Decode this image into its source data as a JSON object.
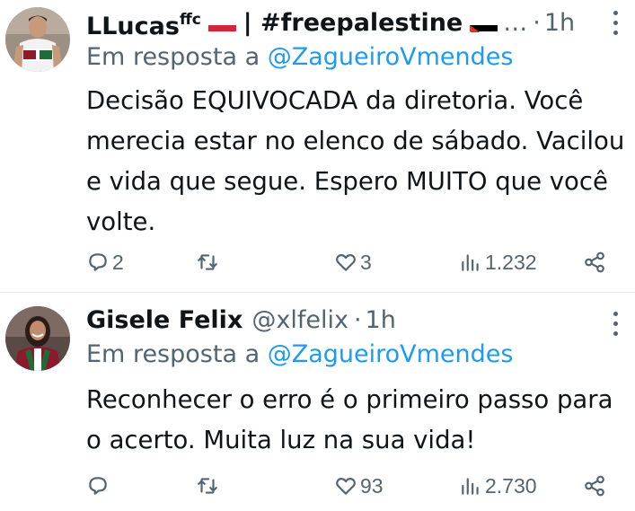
{
  "tweets": [
    {
      "display_name": "LLucas",
      "name_superscript": "ffc",
      "hashtag": "| #freepalestine",
      "ellipsis": "…",
      "separator": "·",
      "time": "1h",
      "reply_prefix": "Em resposta a",
      "reply_mention": "@ZagueiroVmendes",
      "text": "Decisão EQUIVOCADA da diretoria. Você merecia estar no elenco de sábado. Vacilou e vida que segue. Espero MUITO que você volte.",
      "replies": "2",
      "retweets": "",
      "likes": "3",
      "views": "1.232"
    },
    {
      "display_name": "Gisele Felix",
      "handle": "@xlfelix",
      "separator": "·",
      "time": "1h",
      "reply_prefix": "Em resposta a",
      "reply_mention": "@ZagueiroVmendes",
      "text": "Reconhecer o erro é o primeiro passo para o acerto. Muita luz na sua vida!",
      "replies": "",
      "retweets": "",
      "likes": "93",
      "views": "2.730"
    }
  ],
  "colors": {
    "text": "#0f1419",
    "secondary": "#536471",
    "mention": "#1d9bf0",
    "divider": "#e7e9ea"
  },
  "icons": [
    "reply-icon",
    "retweet-icon",
    "like-icon",
    "views-icon",
    "share-icon",
    "more-icon",
    "hungary-flag-icon",
    "palestine-flag-icon"
  ]
}
